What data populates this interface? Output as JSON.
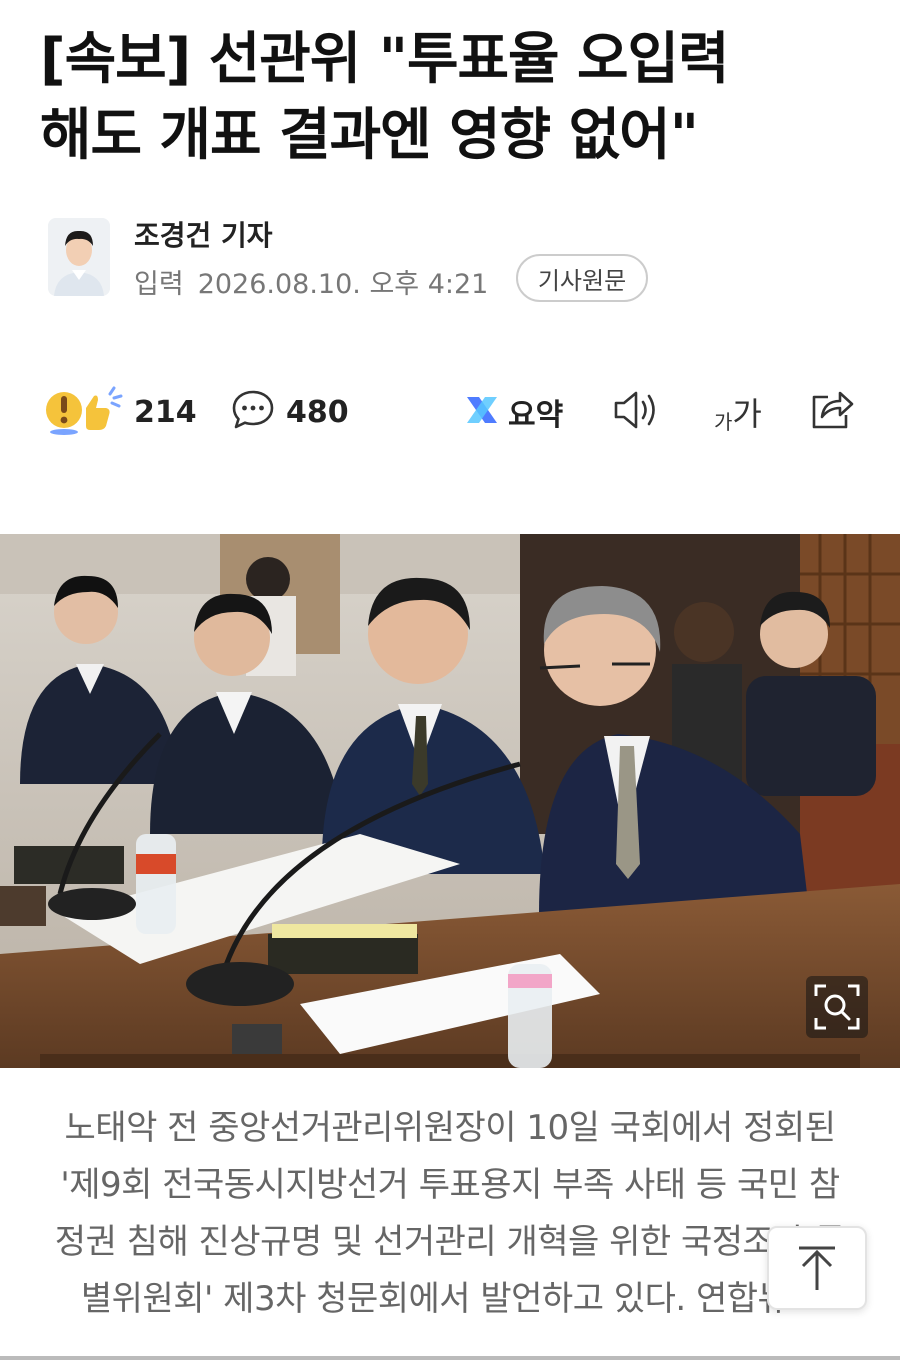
{
  "article": {
    "headline_line1": "[속보] 선관위 \"투표율 오입력",
    "headline_line2": "해도 개표 결과엔 영향 없어\""
  },
  "byline": {
    "reporter": "조경건 기자",
    "date_label": "입력",
    "date": "2026.08.10. 오후 4:21",
    "original_button": "기사원문"
  },
  "toolbar": {
    "reaction_count": "214",
    "comment_count": "480",
    "summary_label": "요약",
    "font_label_small": "가",
    "font_label_large": "가",
    "icons": [
      "reaction-icon",
      "comment-icon",
      "summary-icon",
      "speaker-icon",
      "font-size-icon",
      "share-icon"
    ]
  },
  "photo": {
    "caption_line1": "노태악 전 중앙선거관리위원장이 10일 국회에서 정회된",
    "caption_line2": "'제9회 전국동시지방선거 투표용지 부족 사태 등 국민 참",
    "caption_line3": "정권 침해 진상규명 및 선거관리 개혁을 위한 국정조사 특",
    "caption_line4": "별위원회' 제3차 청문회에서 발언하고 있다. 연합뉴스"
  },
  "colors": {
    "summary_accent": "#4f7cff",
    "reaction_yellow": "#f5c33b",
    "text_muted": "#777777"
  }
}
